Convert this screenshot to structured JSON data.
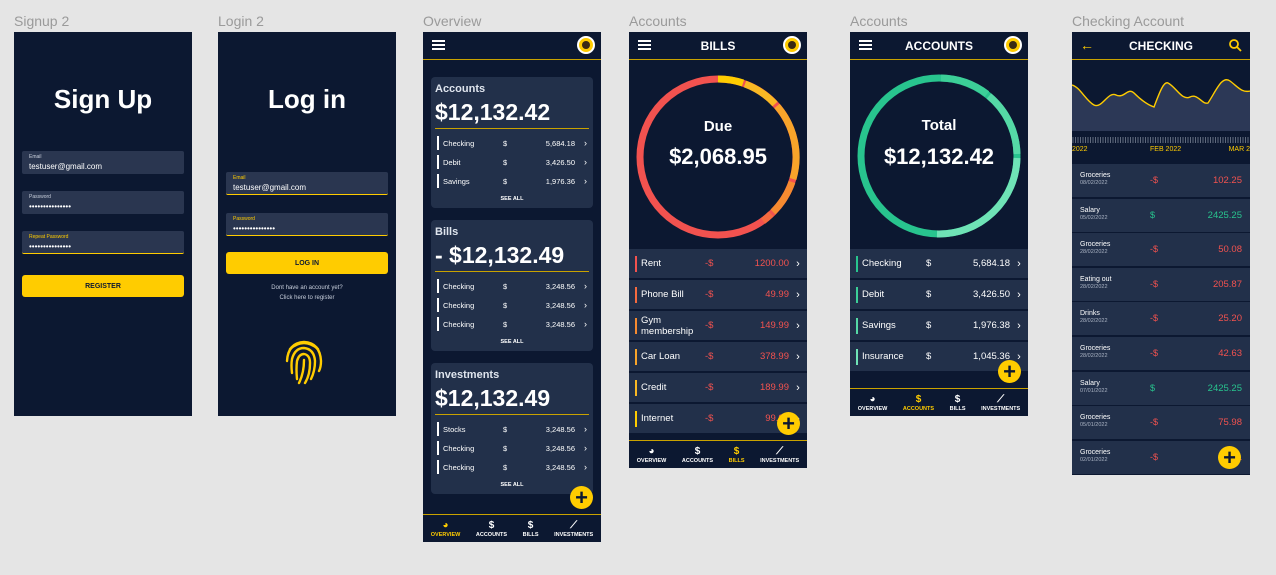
{
  "colors": {
    "bg": "#0c1831",
    "card": "#22304a",
    "accent": "#ffcc00",
    "negative": "#f2524f",
    "positive": "#28c48e"
  },
  "frame_labels": [
    "Signup 2",
    "Login 2",
    "Overview",
    "Accounts",
    "Accounts",
    "Checking Account"
  ],
  "signup": {
    "title": "Sign Up",
    "email_label": "Email",
    "email_value": "testuser@gmail.com",
    "password_label": "Password",
    "password_value": "•••••••••••••••",
    "repeat_label": "Repeat Password",
    "repeat_value": "•••••••••••••••",
    "register": "REGISTER"
  },
  "login": {
    "title": "Log in",
    "email_label": "Email",
    "email_value": "testuser@gmail.com",
    "password_label": "Password",
    "password_value": "•••••••••••••••",
    "login_btn": "LOG IN",
    "no_account": "Dont have an account yet?",
    "register_link": "Click here to register",
    "fingerprint_icon": "fingerprint-icon"
  },
  "overview": {
    "accounts": {
      "title": "Accounts",
      "amount": "$12,132.42",
      "rows": [
        {
          "name": "Checking",
          "cur": "$",
          "val": "5,684.18"
        },
        {
          "name": "Debit",
          "cur": "$",
          "val": "3,426.50"
        },
        {
          "name": "Savings",
          "cur": "$",
          "val": "1,976.36"
        }
      ]
    },
    "bills": {
      "title": "Bills",
      "amount": "- $12,132.49",
      "rows": [
        {
          "name": "Checking",
          "cur": "$",
          "val": "3,248.56"
        },
        {
          "name": "Checking",
          "cur": "$",
          "val": "3,248.56"
        },
        {
          "name": "Checking",
          "cur": "$",
          "val": "3,248.56"
        }
      ]
    },
    "investments": {
      "title": "Investments",
      "amount": "$12,132.49",
      "rows": [
        {
          "name": "Stocks",
          "cur": "$",
          "val": "3,248.56"
        },
        {
          "name": "Checking",
          "cur": "$",
          "val": "3,248.56"
        },
        {
          "name": "Checking",
          "cur": "$",
          "val": "3,248.56"
        }
      ]
    },
    "see_all": "SEE ALL",
    "chev": "›"
  },
  "nav": {
    "overview": "OVERVIEW",
    "accounts": "ACCOUNTS",
    "bills": "BILLS",
    "investments": "INVESTMENTS",
    "overview_icon": "◕",
    "accounts_icon": "$",
    "bills_icon": "$",
    "investments_icon": "⟋"
  },
  "bills_screen": {
    "title": "BILLS",
    "ring_label": "Due",
    "ring_amount": "$2,068.95",
    "rows": [
      {
        "name": "Rent",
        "cur": "-$",
        "val": "1200.00",
        "color": "#f2524f"
      },
      {
        "name": "Phone Bill",
        "cur": "-$",
        "val": "49.99",
        "color": "#f56a3f"
      },
      {
        "name": "Gym membership",
        "cur": "-$",
        "val": "149.99",
        "color": "#f68a30"
      },
      {
        "name": "Car Loan",
        "cur": "-$",
        "val": "378.99",
        "color": "#f8a42a"
      },
      {
        "name": "Credit",
        "cur": "-$",
        "val": "189.99",
        "color": "#f9b824"
      },
      {
        "name": "Internet",
        "cur": "-$",
        "val": "99.99",
        "color": "#ffcc00"
      }
    ]
  },
  "accounts_screen": {
    "title": "ACCOUNTS",
    "ring_label": "Total",
    "ring_amount": "$12,132.42",
    "rows": [
      {
        "name": "Checking",
        "cur": "$",
        "val": "5,684.18",
        "color": "#28c48e"
      },
      {
        "name": "Debit",
        "cur": "$",
        "val": "3,426.50",
        "color": "#3ccf98"
      },
      {
        "name": "Savings",
        "cur": "$",
        "val": "1,976.38",
        "color": "#55d9a6"
      },
      {
        "name": "Insurance",
        "cur": "$",
        "val": "1,045.36",
        "color": "#6fe3b6"
      }
    ]
  },
  "checking": {
    "title": "CHECKING",
    "back_icon": "arrow-left-icon",
    "search_icon": "search-icon",
    "axis": [
      "2022",
      "FEB 2022",
      "MAR 2"
    ],
    "transactions": [
      {
        "name": "Groceries",
        "date": "08/02/2022",
        "cur": "-$",
        "val": "102.25",
        "type": "out"
      },
      {
        "name": "Salary",
        "date": "05/02/2022",
        "cur": "$",
        "val": "2425.25",
        "type": "in"
      },
      {
        "name": "Groceries",
        "date": "28/02/2022",
        "cur": "-$",
        "val": "50.08",
        "type": "out"
      },
      {
        "name": "Eating out",
        "date": "28/02/2022",
        "cur": "-$",
        "val": "205.87",
        "type": "out"
      },
      {
        "name": "Drinks",
        "date": "28/02/2022",
        "cur": "-$",
        "val": "25.20",
        "type": "out"
      },
      {
        "name": "Groceries",
        "date": "28/02/2022",
        "cur": "-$",
        "val": "42.63",
        "type": "out"
      },
      {
        "name": "Salary",
        "date": "07/01/2022",
        "cur": "$",
        "val": "2425.25",
        "type": "in"
      },
      {
        "name": "Groceries",
        "date": "05/01/2022",
        "cur": "-$",
        "val": "75.98",
        "type": "out"
      },
      {
        "name": "Groceries",
        "date": "02/01/2022",
        "cur": "-$",
        "val": "1",
        "type": "out"
      }
    ]
  },
  "fab_label": "+"
}
